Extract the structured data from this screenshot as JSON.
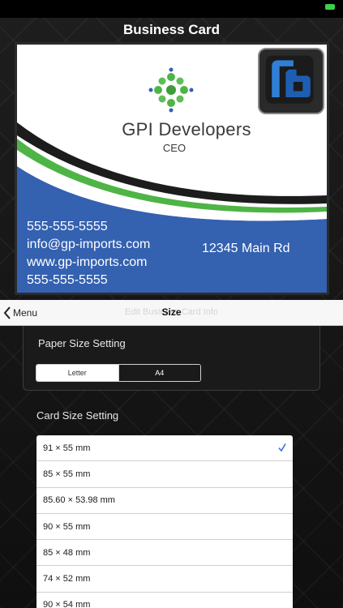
{
  "screen": {
    "title": "Business Card"
  },
  "card": {
    "company": "GPI Developers",
    "role": "CEO",
    "contact_lines": [
      "555-555-5555",
      "info@gp-imports.com",
      "www.gp-imports.com",
      "555-555-5555"
    ],
    "address": "12345 Main Rd",
    "colors": {
      "blue": "#3461b0",
      "green": "#4eb446",
      "black": "#1c1c1c"
    }
  },
  "navbar": {
    "back_label": "Menu",
    "ghost_title": "Edit Business Card Info",
    "title": "Size"
  },
  "paper_size": {
    "label": "Paper Size Setting",
    "options": [
      "Letter",
      "A4"
    ],
    "selected": "Letter"
  },
  "card_size": {
    "label": "Card Size Setting",
    "options": [
      "91 × 55 mm",
      "85 × 55 mm",
      "85.60 × 53.98 mm",
      "90 × 55 mm",
      "85 × 48 mm",
      "74 × 52 mm",
      "90 × 54 mm"
    ],
    "selected": "91 × 55 mm"
  },
  "accent_color": "#3a6fd8",
  "icons": [
    "chevron-left-icon",
    "checkmark-icon",
    "molecule-logo-icon",
    "app-badge-icon",
    "battery-icon"
  ]
}
